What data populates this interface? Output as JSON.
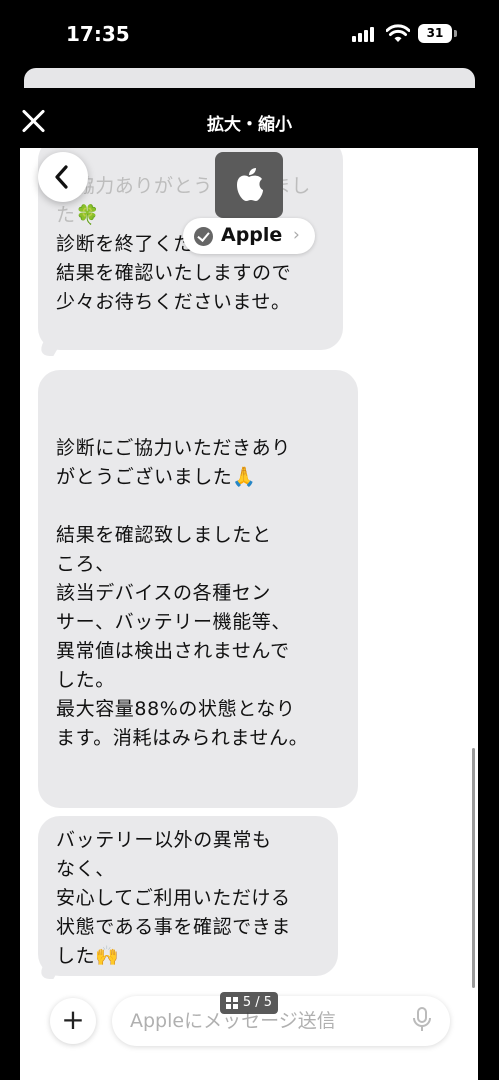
{
  "status_bar": {
    "time": "17:35",
    "battery": "31"
  },
  "viewer": {
    "title": "拡大・縮小"
  },
  "chat": {
    "contact_name": "Apple",
    "contact_chevron": "›",
    "messages": [
      {
        "faded_text": "ご協力ありがとうございました🍀",
        "text": "診断を終了くださいませ。\n結果を確認いたしますので\n少々お待ちくださいませ。"
      },
      {
        "text": "診断にご協力いただきあり\nがとうございました🙏\n\n結果を確認致しましたと\nころ、\n該当デバイスの各種セン\nサー、バッテリー機能等、\n異常値は検出されませんで\nした。\n最大容量88%の状態となり\nます。消耗はみられません。"
      },
      {
        "text": "バッテリー以外の異常も\nなく、\n安心してご利用いただける\n状態である事を確認できま\nした🙌"
      }
    ]
  },
  "composer": {
    "plus_label": "+",
    "placeholder": "Appleにメッセージ送信"
  },
  "pager": {
    "label": "5 / 5"
  }
}
